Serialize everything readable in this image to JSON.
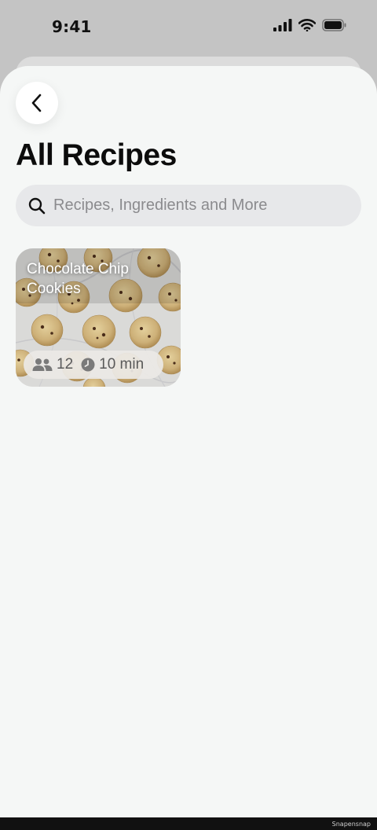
{
  "status_bar": {
    "time": "9:41"
  },
  "header": {
    "title": "All Recipes"
  },
  "search": {
    "placeholder": "Recipes, Ingredients and More"
  },
  "recipes": [
    {
      "title": "Chocolate Chip Cookies",
      "servings": "12",
      "duration": "10 min"
    }
  ],
  "watermark": "Snapensnap",
  "colors": {
    "sheet_background": "#f5f7f6",
    "search_background": "#e7e8ea",
    "title": "#0c0c0c"
  },
  "icons": [
    "cellular-signal-icon",
    "wifi-icon",
    "battery-icon",
    "chevron-left-icon",
    "search-icon",
    "people-icon",
    "clock-icon"
  ]
}
